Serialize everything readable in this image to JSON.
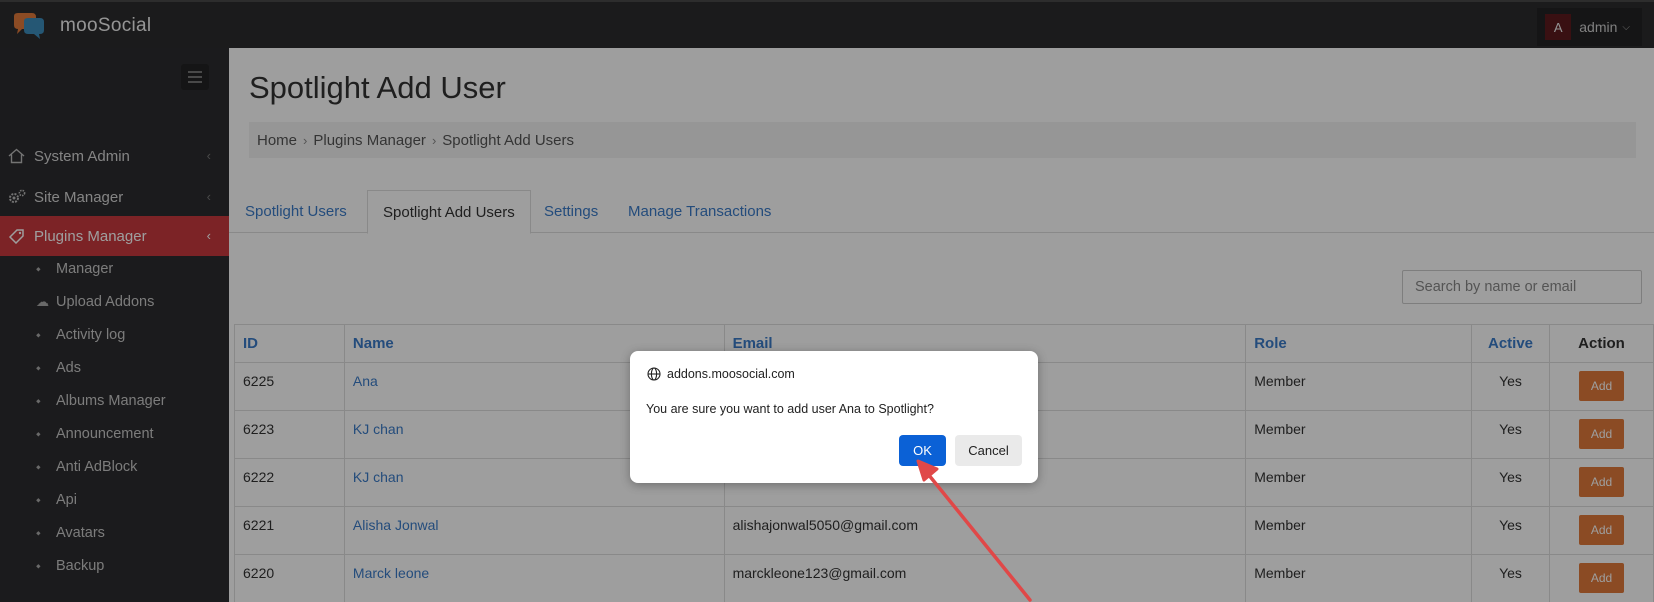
{
  "header": {
    "brand": "mooSocial",
    "user_initial": "A",
    "username": "admin"
  },
  "sidebar": {
    "sections": [
      {
        "label": "System Admin",
        "icon": "home-icon"
      },
      {
        "label": "Site Manager",
        "icon": "gears-icon"
      },
      {
        "label": "Plugins Manager",
        "icon": "tag-icon",
        "active": true
      }
    ],
    "items": [
      {
        "label": "Manager"
      },
      {
        "label": "Upload Addons"
      },
      {
        "label": "Activity log"
      },
      {
        "label": "Ads"
      },
      {
        "label": "Albums Manager"
      },
      {
        "label": "Announcement"
      },
      {
        "label": "Anti AdBlock"
      },
      {
        "label": "Api"
      },
      {
        "label": "Avatars"
      },
      {
        "label": "Backup"
      }
    ]
  },
  "page": {
    "title": "Spotlight Add User",
    "breadcrumb": [
      "Home",
      "Plugins Manager",
      "Spotlight Add Users"
    ],
    "tabs": [
      {
        "label": "Spotlight Users"
      },
      {
        "label": "Spotlight Add Users",
        "active": true
      },
      {
        "label": "Settings"
      },
      {
        "label": "Manage Transactions"
      }
    ],
    "search_placeholder": "Search by name or email"
  },
  "table": {
    "headers": [
      "ID",
      "Name",
      "Email",
      "Role",
      "Active",
      "Action"
    ],
    "rows": [
      {
        "id": "6225",
        "name": "Ana",
        "email": "",
        "role": "Member",
        "active": "Yes",
        "action": "Add"
      },
      {
        "id": "6223",
        "name": "KJ chan",
        "email": "",
        "role": "Member",
        "active": "Yes",
        "action": "Add"
      },
      {
        "id": "6222",
        "name": "KJ chan",
        "email": "",
        "role": "Member",
        "active": "Yes",
        "action": "Add"
      },
      {
        "id": "6221",
        "name": "Alisha Jonwal",
        "email": "alishajonwal5050@gmail.com",
        "role": "Member",
        "active": "Yes",
        "action": "Add"
      },
      {
        "id": "6220",
        "name": "Marck leone",
        "email": "marckleone123@gmail.com",
        "role": "Member",
        "active": "Yes",
        "action": "Add"
      }
    ]
  },
  "dialog": {
    "origin": "addons.moosocial.com",
    "message": "You are sure you want to add user Ana to Spotlight?",
    "ok_label": "OK",
    "cancel_label": "Cancel"
  },
  "colors": {
    "accent_red": "#c9393e",
    "link_blue": "#3a7bc8",
    "add_orange": "#e07a3a",
    "ok_blue": "#0b61d6",
    "arrow_red": "#e04848"
  }
}
